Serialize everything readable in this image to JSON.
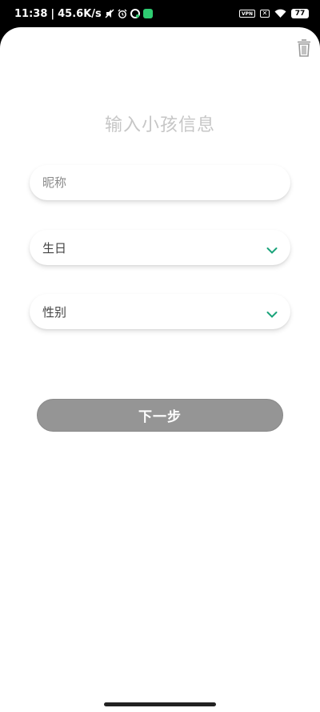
{
  "status_bar": {
    "time": "11:38",
    "network_speed": "45.6K/s",
    "vpn_label": "VPN",
    "battery": "77"
  },
  "page": {
    "title": "输入小孩信息"
  },
  "form": {
    "nickname_placeholder": "昵称",
    "birthday_label": "生日",
    "gender_label": "性别",
    "next_button_label": "下一步"
  },
  "colors": {
    "accent": "#1aa37a",
    "button_disabled": "#959595",
    "title_gray": "#c6c6c6"
  },
  "icons": [
    "trash-icon",
    "chevron-down-icon",
    "wifi-icon",
    "alarm-icon",
    "mute-icon"
  ]
}
